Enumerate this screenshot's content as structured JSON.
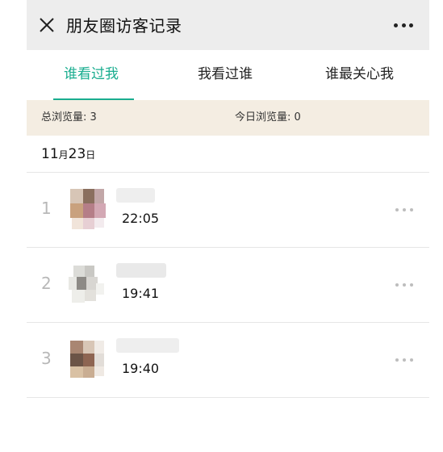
{
  "header": {
    "title": "朋友圈访客记录"
  },
  "tabs": [
    {
      "label": "谁看过我",
      "active": true
    },
    {
      "label": "我看过谁",
      "active": false
    },
    {
      "label": "谁最关心我",
      "active": false
    }
  ],
  "stats": {
    "total": "总浏览量: 3",
    "today": "今日浏览量: 0"
  },
  "date": {
    "day": "11",
    "month_char": "月",
    "date": "23",
    "day_char": "日"
  },
  "visitors": [
    {
      "index": "1",
      "time": "22:05"
    },
    {
      "index": "2",
      "time": "19:41"
    },
    {
      "index": "3",
      "time": "19:40"
    }
  ],
  "colors": {
    "accent": "#1aad8f",
    "stats_bg": "#f4ede2",
    "topbar_bg": "#ededed"
  },
  "icons": {
    "close": "close-icon",
    "more": "more-icon"
  }
}
